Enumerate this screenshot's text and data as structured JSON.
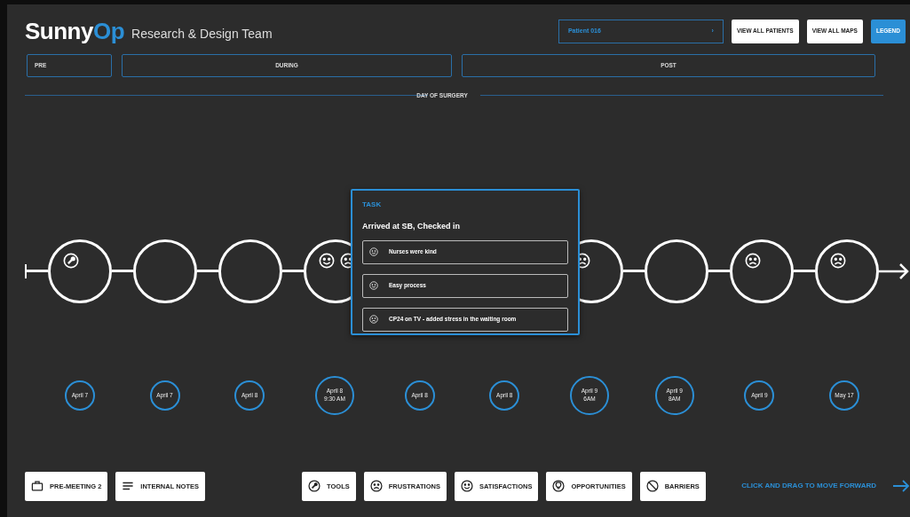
{
  "header": {
    "logo_part_1": "Sunny",
    "logo_part_2": "Op",
    "subtitle": "Research & Design Team",
    "patient_select": {
      "value": "Patient 016",
      "chevron": "›"
    },
    "buttons": [
      {
        "label": "VIEW ALL PATIENTS",
        "kind": "light"
      },
      {
        "label": "VIEW ALL MAPS",
        "kind": "light"
      },
      {
        "label": "LEGEND",
        "kind": "primary"
      }
    ]
  },
  "phases": [
    {
      "label": "PRE"
    },
    {
      "label": "DURING"
    },
    {
      "label": "POST"
    }
  ],
  "divider_label": "DAY OF SURGERY",
  "timeline": {
    "nodes": [
      {
        "kind": "step",
        "marks": [
          {
            "kind": "tools"
          }
        ]
      },
      {
        "kind": "step"
      },
      {
        "kind": "step"
      },
      {
        "kind": "step",
        "marks": [
          {
            "kind": "satisfaction"
          },
          {
            "kind": "frustration"
          }
        ]
      },
      {
        "kind": "hidden"
      },
      {
        "kind": "hidden"
      },
      {
        "kind": "step",
        "marks": [
          {
            "kind": "frustration"
          }
        ]
      },
      {
        "kind": "step"
      },
      {
        "kind": "step",
        "marks": [
          {
            "kind": "frustration"
          }
        ]
      },
      {
        "kind": "step",
        "marks": [
          {
            "kind": "frustration"
          }
        ]
      }
    ]
  },
  "popup": {
    "heading": "TASK",
    "title": "Arrived at SB, Checked in",
    "items": [
      {
        "kind": "satisfaction",
        "text": "Nurses were kind"
      },
      {
        "kind": "satisfaction",
        "text": "Easy process"
      },
      {
        "kind": "frustration",
        "text": "CP24 on TV - added stress in the waiting room"
      }
    ]
  },
  "dates": [
    {
      "lines": [
        "April 7"
      ]
    },
    {
      "lines": [
        "April 7"
      ]
    },
    {
      "lines": [
        "April 8"
      ]
    },
    {
      "lines": [
        "April 8",
        "9:30 AM"
      ]
    },
    {
      "lines": [
        "April 8"
      ]
    },
    {
      "lines": [
        "April 8"
      ]
    },
    {
      "lines": [
        "April 9",
        "6AM"
      ]
    },
    {
      "lines": [
        "April 9",
        "8AM"
      ]
    },
    {
      "lines": [
        "April 9"
      ]
    },
    {
      "lines": [
        "May 17"
      ]
    }
  ],
  "bottom_left_buttons": [
    {
      "kind": "briefcase",
      "label": "PRE-MEETING 2"
    },
    {
      "kind": "notes",
      "label": "INTERNAL NOTES"
    }
  ],
  "filter_buttons": [
    {
      "kind": "tools",
      "label": "TOOLS"
    },
    {
      "kind": "frustration",
      "label": "FRUSTRATIONS"
    },
    {
      "kind": "satisfaction",
      "label": "SATISFACTIONS"
    },
    {
      "kind": "opportunity",
      "label": "OPPORTUNITIES"
    },
    {
      "kind": "barrier",
      "label": "BARRIERS"
    }
  ],
  "hint": "CLICK AND DRAG TO MOVE FORWARD"
}
